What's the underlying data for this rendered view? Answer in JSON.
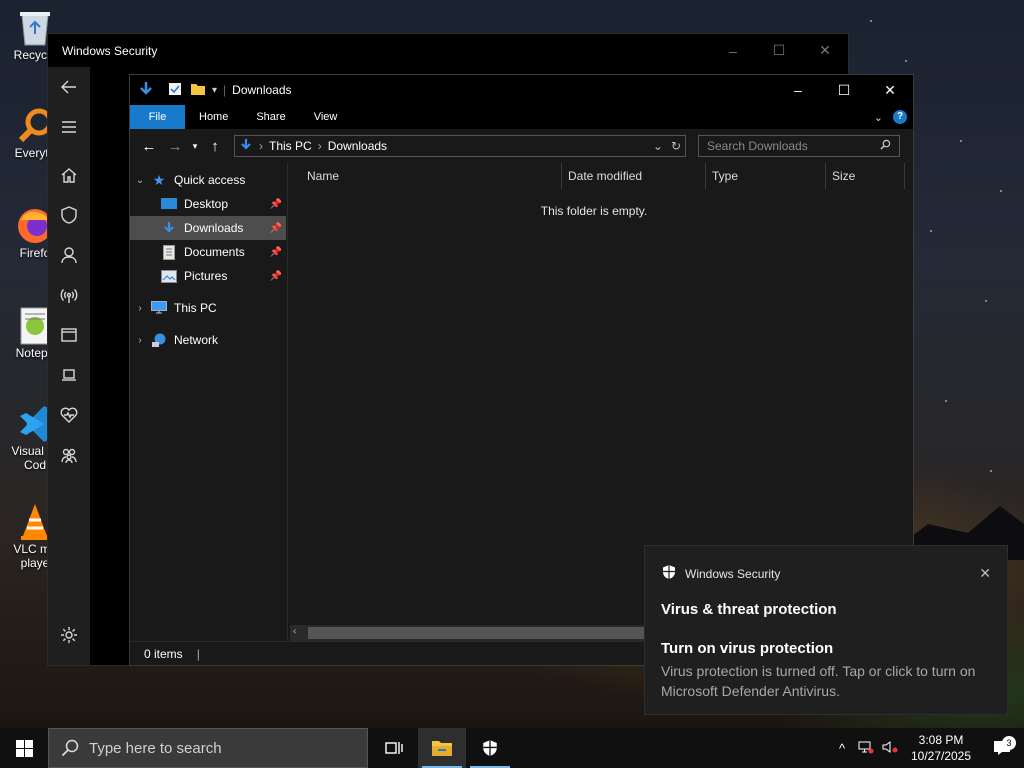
{
  "desktop": {
    "icons": [
      {
        "label": "Recycle",
        "icon": "recycle-bin-icon"
      },
      {
        "label": "Everyth",
        "icon": "everything-search-icon"
      },
      {
        "label": "Firefo",
        "icon": "firefox-icon"
      },
      {
        "label": "Notepa",
        "icon": "notepad-plus-plus-icon"
      },
      {
        "label": "Visual St\nCod",
        "icon": "vscode-icon"
      },
      {
        "label": "VLC me\nplaye",
        "icon": "vlc-icon"
      }
    ]
  },
  "security_window": {
    "title": "Windows Security",
    "controls": {
      "minimize": "–",
      "maximize": "☐",
      "close": "✕"
    }
  },
  "explorer": {
    "title": "Downloads",
    "ribbon_tabs": [
      "File",
      "Home",
      "Share",
      "View"
    ],
    "help": "?",
    "address": {
      "root": "This PC",
      "current": "Downloads"
    },
    "search_placeholder": "Search Downloads",
    "nav": {
      "quick_access": "Quick access",
      "items": [
        "Desktop",
        "Downloads",
        "Documents",
        "Pictures"
      ],
      "this_pc": "This PC",
      "network": "Network"
    },
    "columns": [
      "Name",
      "Date modified",
      "Type",
      "Size"
    ],
    "empty_message": "This folder is empty.",
    "status": "0 items"
  },
  "toast": {
    "app": "Windows Security",
    "section": "Virus & threat protection",
    "heading": "Turn on virus protection",
    "body": "Virus protection is turned off. Tap or click to turn on Microsoft Defender Antivirus."
  },
  "taskbar": {
    "search_placeholder": "Type here to search",
    "time": "3:08 PM",
    "date": "10/27/2025",
    "notification_count": "3"
  },
  "colors": {
    "accent": "#1979ca",
    "selected": "#4d4d4d",
    "taskbar": "#101010"
  }
}
